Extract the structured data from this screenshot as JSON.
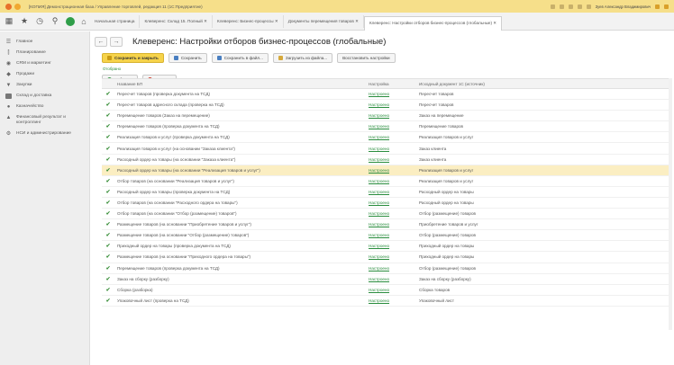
{
  "window": {
    "title": "[КОПИЯ] Демонстрационная база / Управление торговлей, редакция 11 (1С:Предприятие)",
    "user": "Зуев Александр Владимирович"
  },
  "tabs": [
    {
      "label": "Начальная страница"
    },
    {
      "label": "Клеверенс: Склад 15. Полный ✕"
    },
    {
      "label": "Клеверенс: Бизнес-процессы ✕"
    },
    {
      "label": "Документы перемещения товаров ✕"
    },
    {
      "label": "Клеверенс: Настройки отборов бизнес-процессов (глобальные) ✕",
      "active": true
    }
  ],
  "sidebar": {
    "items": [
      {
        "label": "Главное",
        "icon": "menu-icon"
      },
      {
        "label": "Планирование",
        "icon": "chart-icon"
      },
      {
        "label": "CRM и маркетинг",
        "icon": "crm-icon"
      },
      {
        "label": "Продажи",
        "icon": "sales-icon"
      },
      {
        "label": "Закупки",
        "icon": "cart-icon"
      },
      {
        "label": "Склад и доставка",
        "icon": "warehouse-icon"
      },
      {
        "label": "Казначейство",
        "icon": "treasury-icon"
      },
      {
        "label": "Финансовый результат и контроллинг",
        "icon": "finance-icon"
      },
      {
        "label": "НСИ и администрирование",
        "icon": "gear-icon"
      }
    ]
  },
  "page": {
    "title": "Клеверенс: Настройки отборов бизнес-процессов (глобальные)",
    "back": "←",
    "forward": "→"
  },
  "toolbar": {
    "save_close": "Сохранить и закрыть",
    "save": "Сохранить",
    "save_file": "Сохранить в файл...",
    "load_file": "Загрузить из файла...",
    "restore": "Восстановить настройки"
  },
  "link": "Отобрано",
  "toolbar2": {
    "add": "Добавить",
    "delete": "Удалить"
  },
  "table": {
    "columns": [
      "Название БП",
      "Настройка",
      "Исходный документ 1С (источник)"
    ],
    "rows": [
      {
        "name": "Пересчет товаров (проверка документа на ТСД)",
        "setting": "Настроено",
        "source": "Пересчет товаров"
      },
      {
        "name": "Пересчет товаров адресного склада (проверка на ТСД)",
        "setting": "Настроено",
        "source": "Пересчет товаров"
      },
      {
        "name": "Перемещение товаров (Заказ на перемещение)",
        "setting": "Настроено",
        "source": "Заказ на перемещение"
      },
      {
        "name": "Перемещение товаров (проверка документа на ТСД)",
        "setting": "Настроено",
        "source": "Перемещение товаров"
      },
      {
        "name": "Реализация товаров и услуг (проверка документа на ТСД)",
        "setting": "Настроено",
        "source": "Реализация товаров и услуг"
      },
      {
        "name": "Реализация товаров и услуг (на основании \"Заказа клиента\")",
        "setting": "Настроено",
        "source": "Заказ клиента"
      },
      {
        "name": "Расходный ордер на товары (на основании \"Заказа клиента\")",
        "setting": "Настроено",
        "source": "Заказ клиента"
      },
      {
        "name": "Расходный ордер на товары (на основании \"Реализация товаров и услуг\")",
        "setting": "Настроено",
        "source": "Реализация товаров и услуг",
        "selected": true
      },
      {
        "name": "Отбор товаров (на основании \"Реализация товаров и услуг\")",
        "setting": "Настроено",
        "source": "Реализация товаров и услуг"
      },
      {
        "name": "Расходный ордер на товары (проверка документа на ТСД)",
        "setting": "Настроено",
        "source": "Расходный ордер на товары"
      },
      {
        "name": "Отбор товаров (на основании \"Расходного ордера на товары\")",
        "setting": "Настроено",
        "source": "Расходный ордер на товары"
      },
      {
        "name": "Отбор товаров (на основании \"Отбор (размещение) товаров\")",
        "setting": "Настроено",
        "source": "Отбор (размещение) товаров"
      },
      {
        "name": "Размещение товаров (на основании \"Приобретение товаров и услуг\")",
        "setting": "Настроено",
        "source": "Приобретение товаров и услуг"
      },
      {
        "name": "Размещение товаров (на основании \"Отбор (размещение) товаров\")",
        "setting": "Настроено",
        "source": "Отбор (размещение) товаров"
      },
      {
        "name": "Приходный ордер на товары (проверка документа на ТСД)",
        "setting": "Настроено",
        "source": "Приходный ордер на товары"
      },
      {
        "name": "Размещение товаров (на основании \"Приходного ордера на товары\")",
        "setting": "Настроено",
        "source": "Приходный ордер на товары"
      },
      {
        "name": "Перемещение товаров (проверка документа на ТСД)",
        "setting": "Настроено",
        "source": "Отбор (размещение) товаров"
      },
      {
        "name": "Заказ на сборку (разборку)",
        "setting": "Настроено",
        "source": "Заказ на сборку (разборку)"
      },
      {
        "name": "Сборка (разборка)",
        "setting": "Настроено",
        "source": "Сборка товаров"
      },
      {
        "name": "Упаковочный лист (проверка на ТСД)",
        "setting": "Настроено",
        "source": "Упаковочный лист"
      }
    ]
  },
  "colors": {
    "accent": "#f6d34a",
    "selected_row": "#fbeec2",
    "link": "#2a8d3e"
  }
}
